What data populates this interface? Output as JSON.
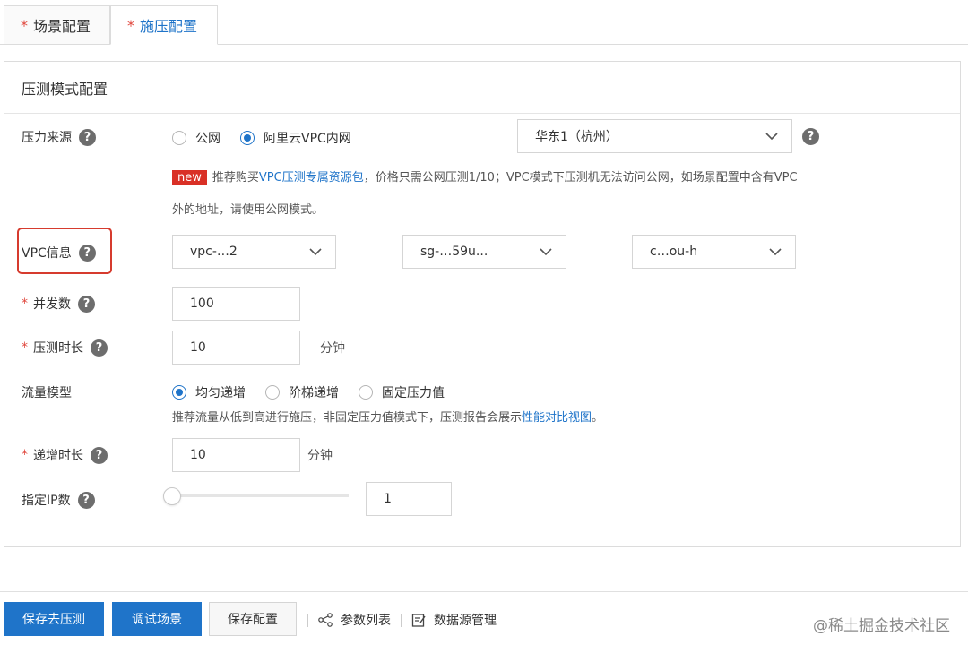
{
  "tabs": [
    {
      "label": "场景配置",
      "required": "*"
    },
    {
      "label": "施压配置",
      "required": "*"
    }
  ],
  "panel": {
    "title": "压测模式配置"
  },
  "pressure_source": {
    "label": "压力来源",
    "options": [
      "公网",
      "阿里云VPC内网"
    ],
    "selected": "阿里云VPC内网",
    "region": "华东1（杭州）"
  },
  "notice": {
    "badge": "new",
    "prefix": "推荐购买",
    "link": "VPC压测专属资源包",
    "suffix_line1": "，价格只需公网压测1/10；VPC模式下压测机无法访问公网，如场景配置中含有VPC",
    "line2": "外的地址，请使用公网模式。"
  },
  "vpc": {
    "label": "VPC信息",
    "vpc_select": "vpc-…2",
    "sg_select": "sg-…59u...",
    "vswitch_select": "c…ou-h"
  },
  "concurrency": {
    "required": "*",
    "label": "并发数",
    "value": "100"
  },
  "duration": {
    "required": "*",
    "label": "压测时长",
    "value": "10",
    "unit": "分钟"
  },
  "traffic_model": {
    "label": "流量模型",
    "options": [
      "均匀递增",
      "阶梯递增",
      "固定压力值"
    ],
    "selected": "均匀递增",
    "hint_prefix": "推荐流量从低到高进行施压，非固定压力值模式下，压测报告会展示",
    "hint_link": "性能对比视图",
    "hint_suffix": "。"
  },
  "ramp": {
    "required": "*",
    "label": "递增时长",
    "value": "10",
    "unit": "分钟"
  },
  "ip_count": {
    "label": "指定IP数",
    "value": "1",
    "slider_level": 0
  },
  "footer": {
    "save_and_run": "保存去压测",
    "debug": "调试场景",
    "save": "保存配置",
    "params": "参数列表",
    "datasource": "数据源管理"
  },
  "watermark": "@稀土掘金技术社区",
  "colors": {
    "accent": "#1f74c9",
    "required": "#e0463c",
    "highlight": "#d63b2e"
  }
}
